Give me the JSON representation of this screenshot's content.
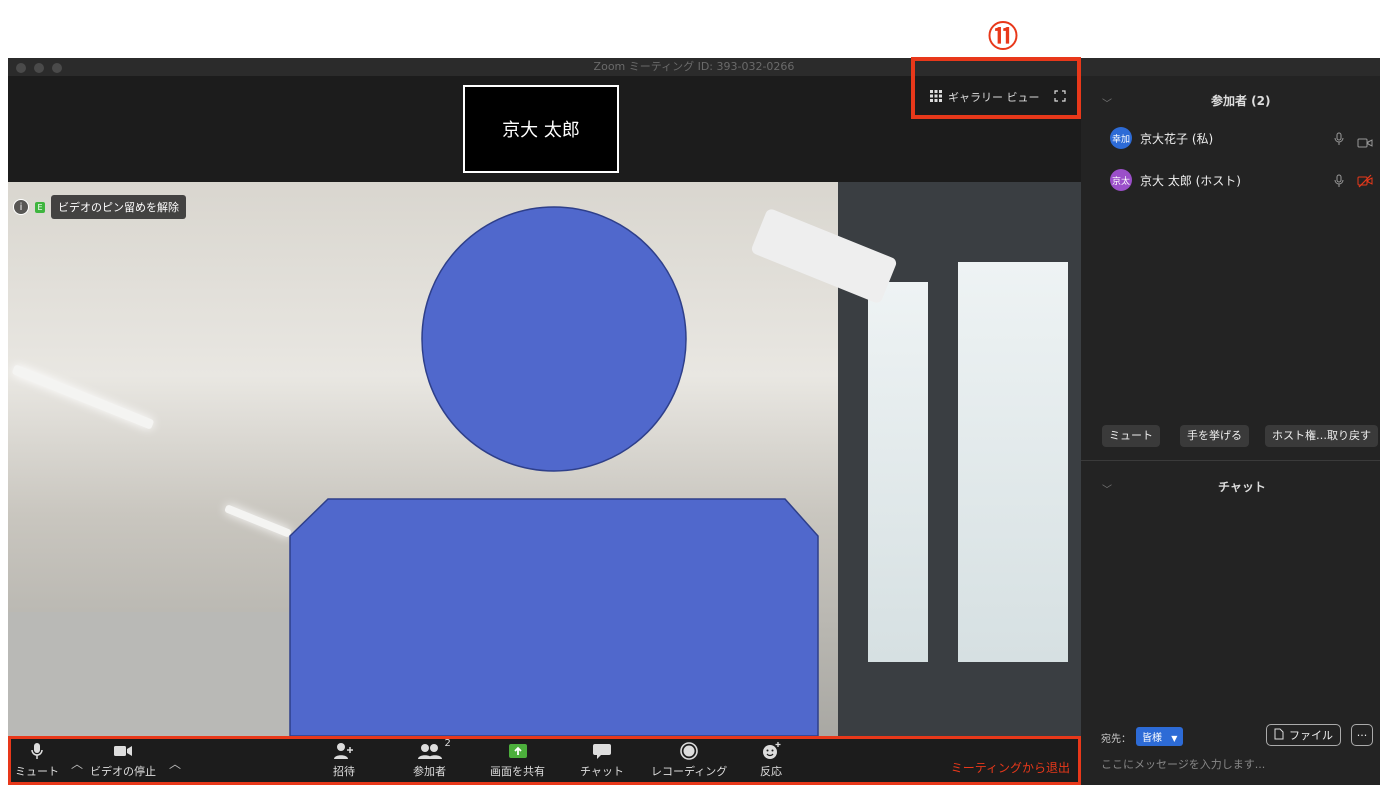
{
  "annotation": {
    "number": "⑪",
    "color": "#e8381a"
  },
  "window": {
    "title": "Zoom ミーティング ID: 393-032-0266"
  },
  "thumbnail": {
    "name": "京大 太郎"
  },
  "view_toggle": {
    "label": "ギャラリー ビュー",
    "icon": "grid-icon",
    "fullscreen_icon": "fullscreen-icon"
  },
  "video": {
    "pin_badge": "E",
    "pin_label": "ビデオのピン留めを解除"
  },
  "toolbar": {
    "mute": "ミュート",
    "stop_video": "ビデオの停止",
    "invite": "招待",
    "participants": "参加者",
    "participants_count": "2",
    "share": "画面を共有",
    "chat": "チャット",
    "record": "レコーディング",
    "reactions": "反応",
    "leave": "ミーティングから退出"
  },
  "participants_panel": {
    "title": "参加者 (2)",
    "items": [
      {
        "avatar": "幸加",
        "avatar_color": "#2d6bd6",
        "name": "京大花子 (私)"
      },
      {
        "avatar": "京太",
        "avatar_color": "#9b4fc9",
        "name": "京大 太郎 (ホスト)"
      }
    ],
    "buttons": {
      "mute": "ミュート",
      "raise_hand": "手を挙げる",
      "reclaim_host": "ホスト権…取り戻す"
    }
  },
  "chat_panel": {
    "title": "チャット",
    "to_label": "宛先：",
    "to_value": "皆様",
    "file_button": "ファイル",
    "more_button": "···",
    "placeholder": "ここにメッセージを入力します..."
  }
}
